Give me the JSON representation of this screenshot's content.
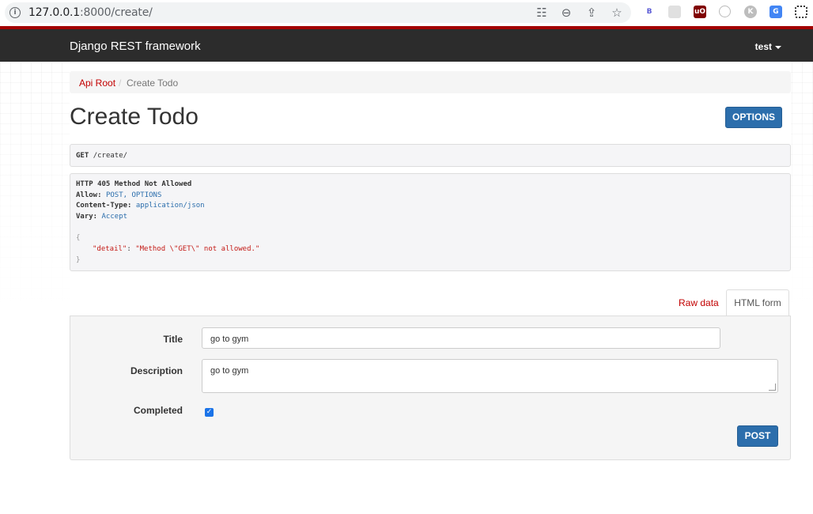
{
  "browser": {
    "url_host": "127.0.0.1",
    "url_rest": ":8000/create/",
    "icons": [
      "info-icon",
      "translate-icon",
      "zoom-out-icon",
      "share-icon",
      "bookmark-star-icon"
    ],
    "extensions": [
      {
        "name": "bitwarden-ext-icon",
        "label": "B",
        "color": "#5b5bd6"
      },
      {
        "name": "qr-ext-icon",
        "label": "",
        "color": "#cccccc"
      },
      {
        "name": "ublock-ext-icon",
        "label": "uO",
        "color": "#800000"
      },
      {
        "name": "tracker-ext-icon",
        "label": "",
        "color": "#dddddd"
      },
      {
        "name": "k-ext-icon",
        "label": "K",
        "color": "#bdbdbd"
      },
      {
        "name": "translate-ext-icon",
        "label": "",
        "color": "#4285f4"
      },
      {
        "name": "qrcode-ext-icon",
        "label": "",
        "color": "#333333"
      }
    ]
  },
  "navbar": {
    "brand": "Django REST framework",
    "user": "test",
    "accent": "#a30000"
  },
  "breadcrumb": {
    "root": "Api Root",
    "separator": "/",
    "current": "Create Todo"
  },
  "page": {
    "title": "Create Todo",
    "options_label": "OPTIONS"
  },
  "request": {
    "method": "GET",
    "path": "/create/"
  },
  "response": {
    "status_line": "HTTP 405 Method Not Allowed",
    "headers": [
      {
        "key": "Allow:",
        "value": "POST, OPTIONS"
      },
      {
        "key": "Content-Type:",
        "value": "application/json"
      },
      {
        "key": "Vary:",
        "value": "Accept"
      }
    ],
    "body_open": "{",
    "body_key": "\"detail\"",
    "body_colon": ": ",
    "body_value": "\"Method \\\"GET\\\" not allowed.\"",
    "body_close": "}"
  },
  "tabs": {
    "raw": "Raw data",
    "html": "HTML form"
  },
  "form": {
    "title_label": "Title",
    "title_value": "go to gym",
    "description_label": "Description",
    "description_value": "go to gym",
    "completed_label": "Completed",
    "completed_checked": true,
    "submit_label": "POST"
  }
}
